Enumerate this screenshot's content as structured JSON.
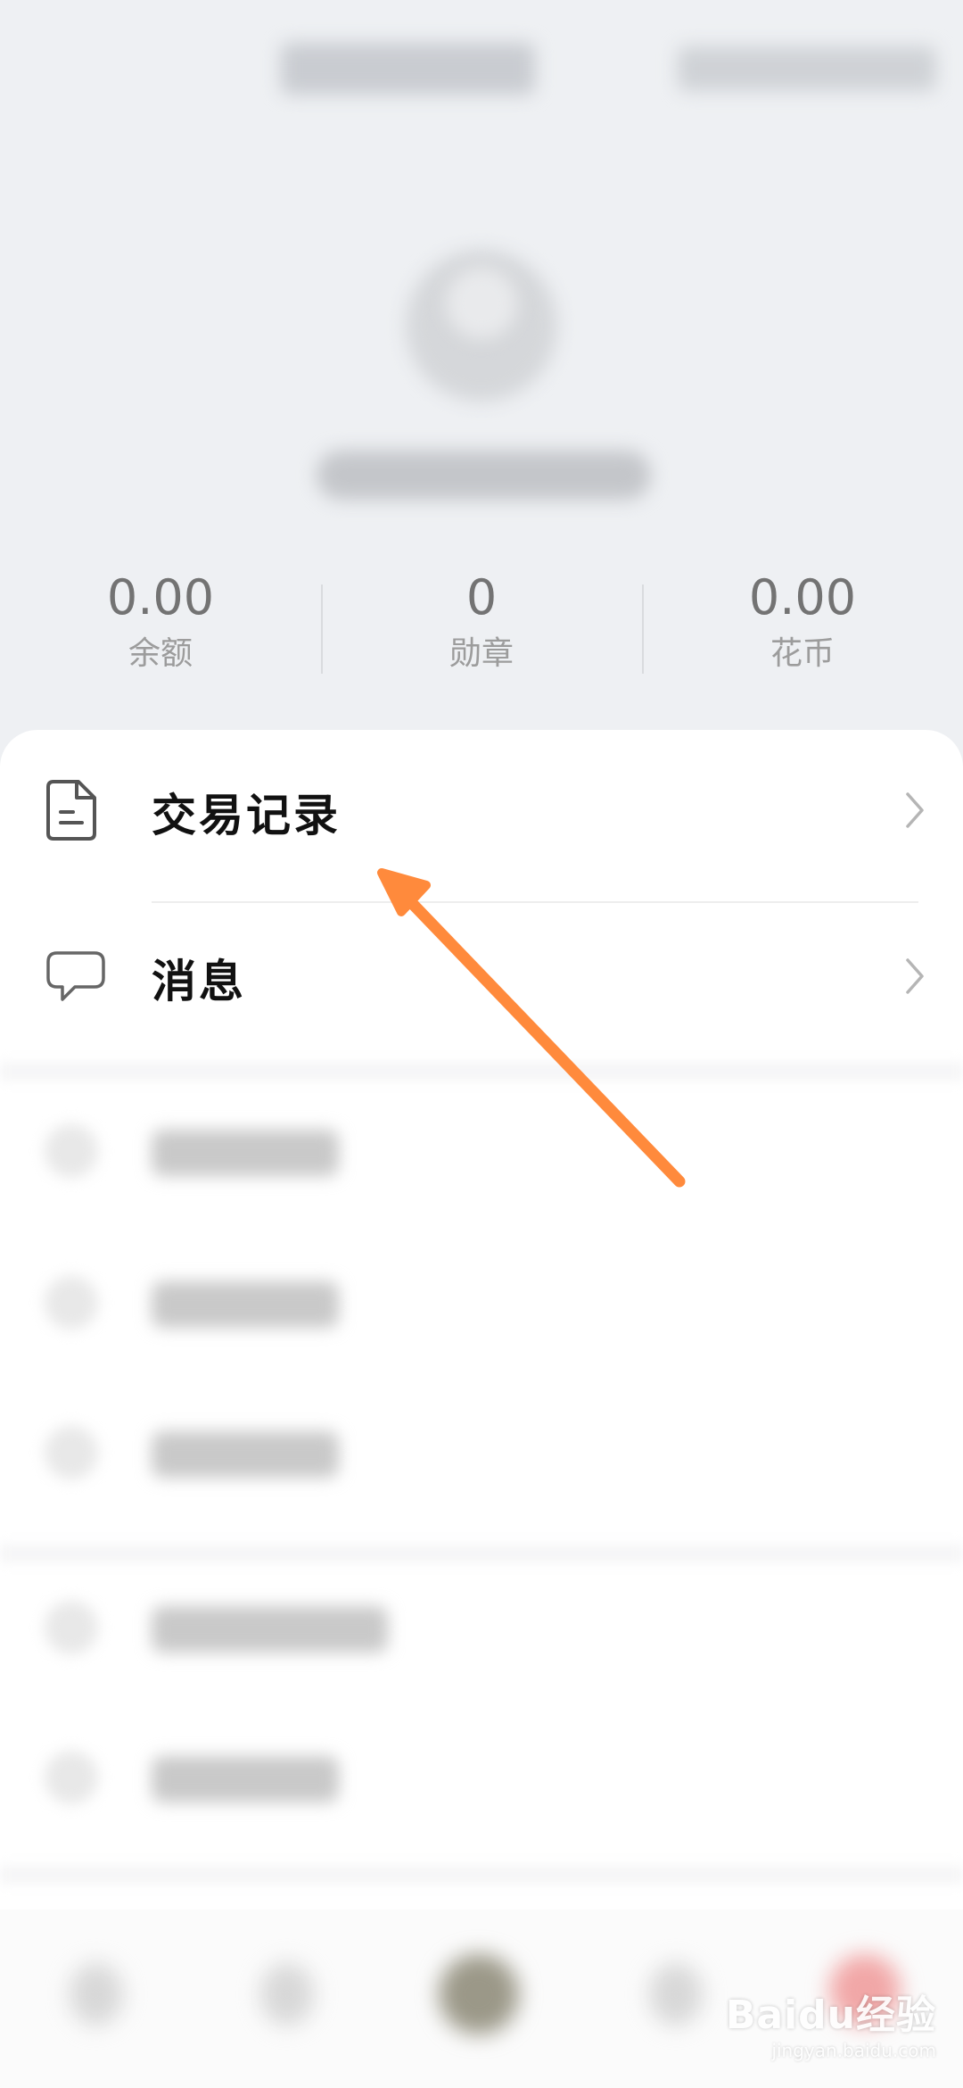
{
  "stats": [
    {
      "value": "0.00",
      "label": "余额"
    },
    {
      "value": "0",
      "label": "勋章"
    },
    {
      "value": "0.00",
      "label": "花币"
    }
  ],
  "menu": {
    "transactions_label": "交易记录",
    "messages_label": "消息"
  },
  "watermark": {
    "brand": "Baidu经验",
    "url": "jingyan.baidu.com"
  },
  "colors": {
    "accent_arrow": "#ff8a3c",
    "background": "#eef0f3",
    "card": "#ffffff"
  }
}
